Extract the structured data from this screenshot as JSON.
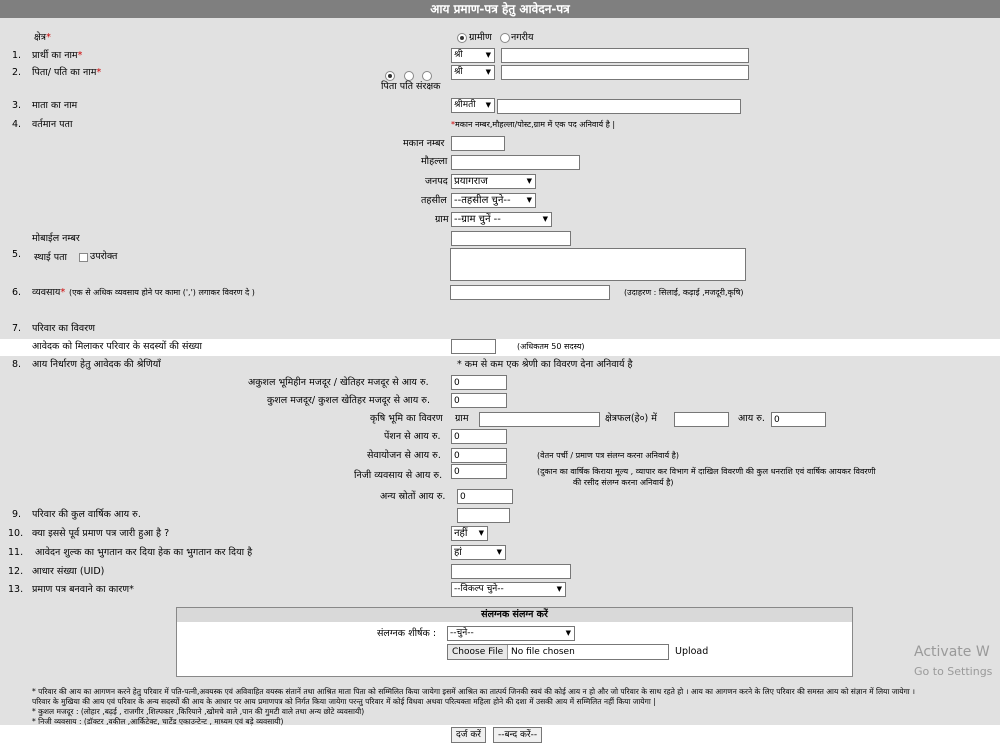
{
  "title": "आय प्रमाण-पत्र हेतु आवेदन-पत्र",
  "area": {
    "label": "क्षेत्र",
    "req": "*",
    "opt_rural": "ग्रामीण",
    "opt_urban": "नगरीय"
  },
  "q1": {
    "num": "1.",
    "label": "प्रार्थी का नाम",
    "req": "*",
    "prefix": "श्री"
  },
  "q2": {
    "num": "2.",
    "label": "पिता/ पति का नाम",
    "req": "*",
    "prefix": "श्री",
    "relation_caption": "पिता पति संरक्षक"
  },
  "q3": {
    "num": "3.",
    "label": "माता का नाम",
    "prefix": "श्रीमती"
  },
  "q4": {
    "num": "4.",
    "label": "वर्तमान पता",
    "note_star": "*",
    "note": "मकान नम्बर,मौहल्ला/पोस्ट,ग्राम में एक पद अनिवार्य है |",
    "house_label": "मकान नम्बर",
    "mohalla_label": "मौहल्ला",
    "janpad_label": "जनपद",
    "janpad_value": "प्रयागराज",
    "tehsil_label": "तहसील",
    "tehsil_value": "--तहसील चुने--",
    "village_label": "ग्राम",
    "village_value": "--ग्राम चुनें --",
    "mobile_label": "मोबाईल नम्बर"
  },
  "q5": {
    "num": "5.",
    "label": "स्थाई पता",
    "checkbox_label": "उपरोक्त"
  },
  "q6": {
    "num": "6.",
    "label": "व्यवसाय",
    "req": "*",
    "hint": "(एक से अधिक व्यवसाय होने पर कामा (',') लगाकर विवरण दे )",
    "example": "(उदाहरण : सिलाई, कढ़ाई ,मजदूरी,कृषि)"
  },
  "q7": {
    "num": "7.",
    "label": "परिवार का विवरण",
    "members_label": "आवेदक को मिलाकर परिवार के सदस्यों की संख्या",
    "members_max": "(अधिकतम 50 सदस्य)"
  },
  "q8": {
    "num": "8.",
    "label": "आय निर्धारण हेतु आवेदक की श्रेणियाँ",
    "note": "* कम से कम एक श्रेणी का विवरण देना अनिवार्य है",
    "unskilled_label": "अकुशल भूमिहीन मजदूर / खेतिहर मजदूर से आय रु.",
    "unskilled_value": "0",
    "skilled_label": "कुशल मजदूर/ कुशल खेतिहर मजदूर से आय रु.",
    "skilled_value": "0",
    "agri_label": "कृषि भूमि का विवरण",
    "agri_village_label": "ग्राम",
    "agri_area_label": "क्षेत्रफल(हे०) में",
    "agri_income_label": "आय रु.",
    "agri_income_value": "0",
    "pension_label": "पेंशन से आय रु.",
    "pension_value": "0",
    "service_label": "सेवायोजन से आय रु.",
    "service_value": "0",
    "service_note": "(वेतन पर्ची / प्रमाण पत्र संलग्न करना अनिवार्य है)",
    "business_label": "निजी व्यवसाय से आय रु.",
    "business_value": "0",
    "business_note_1": "(दुकान का वार्षिक किराया मूल्य , व्यापार कर विभाग में दाखिल विवरणी की कुल धनराशि एवं वार्षिक आयकर विवरणी",
    "business_note_2": "की रसीद संलग्न करना अनिवार्य है)",
    "other_label": "अन्य स्रोतों आय रु.",
    "other_value": "0"
  },
  "q9": {
    "num": "9.",
    "label": "परिवार की कुल वार्षिक आय रु."
  },
  "q10": {
    "num": "10.",
    "label": "क्या इससे पूर्व प्रमाण पत्र जारी हुआ है ?",
    "value": "नहीं"
  },
  "q11": {
    "num": "11.",
    "label": "आवेदन शुल्क का भुगतान कर दिया हेक का भुगतान कर दिया है",
    "value": "हां"
  },
  "q12": {
    "num": "12.",
    "label": "आधार संख्या (UID)"
  },
  "q13": {
    "num": "13.",
    "label": "प्रमाण पत्र बनवाने का कारण",
    "req": "*",
    "value": "--विकल्प चुने--"
  },
  "upload": {
    "header": "संलग्नक संलग्न करें",
    "doc_label": "संलग्नक शीर्षक",
    "colon": ":",
    "doc_value": "--चुने--",
    "choose_file": "Choose File",
    "no_file": "No file chosen",
    "upload_label": "Upload"
  },
  "notes": [
    "* परिवार की आय का आगणन करने हेतु परिवार में पति-पत्नी,अवयस्क एवं अविवाहित वयस्क संतानें तथा आश्रित माता पिता को सम्मिलित किया जायेगा इसमें आश्रित का तात्पर्य जिनकी स्वयं की कोई आय न हो और जो परिवार के साथ रहते हो । आय का आगणन करने के लिए परिवार की समस्त आय को संज्ञान में लिया जायेगा ।",
    "परिवार के मुखिया की आय एवं परिवार के अन्य सदस्यों की आय के आधार पर आय प्रमाणपत्र को निर्गत किया जायेगा परन्तु परिवार में कोई विधवा अथवा परित्यक्ता महिला होने की दशा में उसकी आय में सम्मिलित नहीं किया जायेगा |",
    "* कुशल मजदूर : (लोहार ,बढ़ई , राजगीर ,शिल्पकार ,किरियाने ,खोमचे वाले ,पान की गुमटी वाले तथा अन्य छोटे व्यवसायी)",
    "* निजी व्यवसाय : (डॉक्टर ,वकील ,आर्किटेक्ट, चार्टेड एकाउन्टेन्ट , माध्यम एवं बड़े व्यवसायी)"
  ],
  "buttons": {
    "submit": "दर्ज करें",
    "close": "--बन्द करें--"
  },
  "watermark": {
    "line1": "Activate W",
    "line2": "Go to Settings"
  }
}
